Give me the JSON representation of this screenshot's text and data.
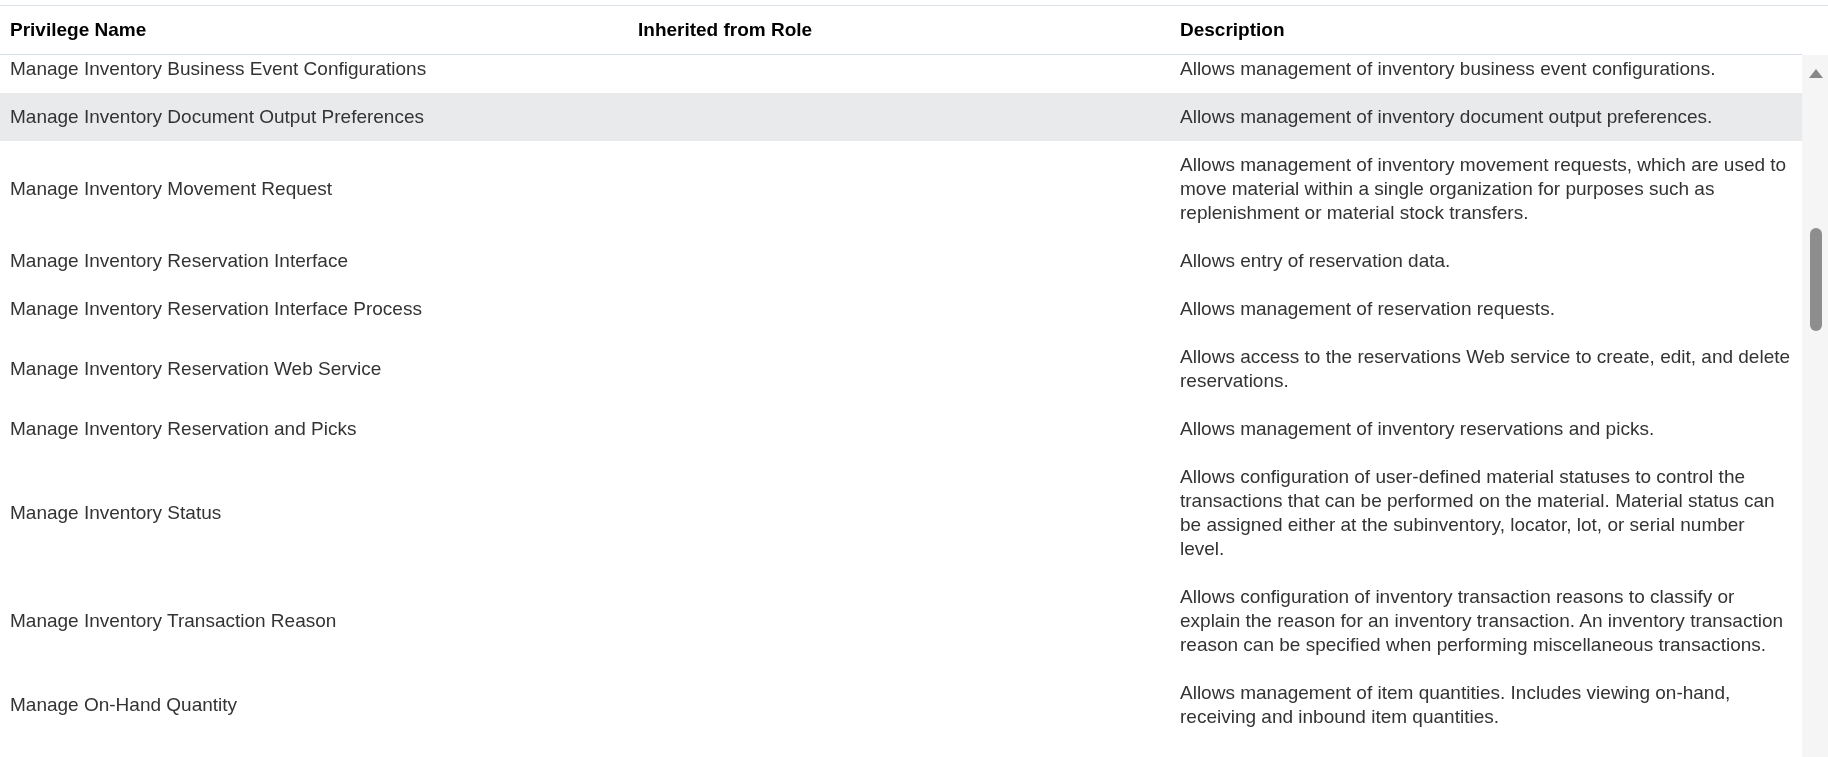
{
  "table": {
    "columns": [
      "Privilege Name",
      "Inherited from Role",
      "Description"
    ],
    "rows": [
      {
        "name": "Manage Inventory Business Event Configurations",
        "description": "Allows management of inventory business event configurations.",
        "selected": false
      },
      {
        "name": "Manage Inventory Document Output Preferences",
        "description": "Allows management of inventory document output preferences.",
        "selected": true
      },
      {
        "name": "Manage Inventory Movement Request",
        "description": "Allows management of inventory movement requests, which are used to move material within a single organization for purposes such as replenishment or material stock transfers.",
        "selected": false
      },
      {
        "name": "Manage Inventory Reservation Interface",
        "description": "Allows entry of reservation data.",
        "selected": false
      },
      {
        "name": "Manage Inventory Reservation Interface Process",
        "description": "Allows management of reservation requests.",
        "selected": false
      },
      {
        "name": "Manage Inventory Reservation Web Service",
        "description": "Allows access to the reservations Web service to create, edit, and delete reservations.",
        "selected": false
      },
      {
        "name": "Manage Inventory Reservation and Picks",
        "description": "Allows management of inventory reservations and picks.",
        "selected": false
      },
      {
        "name": "Manage Inventory Status",
        "description": "Allows configuration of user-defined material statuses to control the transactions that can be performed on the material. Material status can be assigned either at the subinventory, locator, lot, or serial number level.",
        "selected": false
      },
      {
        "name": "Manage Inventory Transaction Reason",
        "description": "Allows configuration of inventory transaction reasons to classify or explain the reason for an inventory transaction. An inventory transaction reason can be specified when performing miscellaneous transactions.",
        "selected": false
      },
      {
        "name": "Manage On-Hand Quantity",
        "description": "Allows management of item quantities. Includes viewing on-hand, receiving and inbound item quantities.",
        "selected": false
      }
    ]
  }
}
